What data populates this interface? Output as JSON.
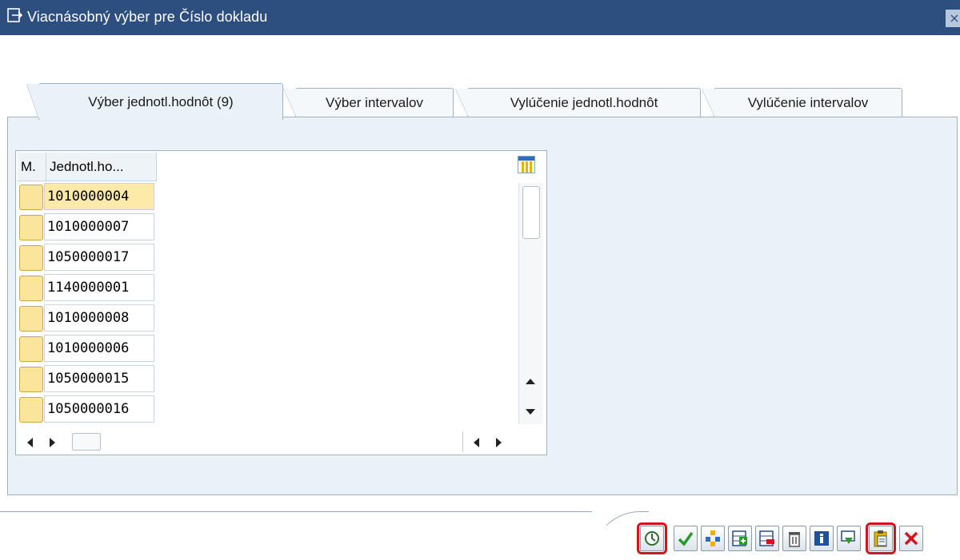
{
  "window": {
    "title": "Viacnásobný výber pre Číslo dokladu",
    "close_label": "×"
  },
  "tabs": [
    {
      "label": "Výber jednotl.hodnôt (9)",
      "active": true
    },
    {
      "label": "Výber intervalov",
      "active": false
    },
    {
      "label": "Vylúčenie jednotl.hodnôt",
      "active": false
    },
    {
      "label": "Vylúčenie intervalov",
      "active": false
    }
  ],
  "grid": {
    "col_m": "M.",
    "col_value": "Jednotl.ho...",
    "rows": [
      "1010000004",
      "1010000007",
      "1050000017",
      "1140000001",
      "1010000008",
      "1010000006",
      "1050000015",
      "1050000016"
    ],
    "focused_row": 0
  },
  "toolbar": {
    "buttons": [
      {
        "icon": "execute-clock-icon",
        "highlighted": true
      },
      {
        "icon": "checkmark-icon",
        "highlighted": false
      },
      {
        "icon": "multiple-selection-icon",
        "highlighted": false
      },
      {
        "icon": "insert-row-icon",
        "highlighted": false
      },
      {
        "icon": "delete-row-icon",
        "highlighted": false
      },
      {
        "icon": "trash-icon",
        "highlighted": false
      },
      {
        "icon": "info-icon",
        "highlighted": false
      },
      {
        "icon": "import-from-file-icon",
        "highlighted": false
      },
      {
        "icon": "paste-clipboard-icon",
        "highlighted": true
      },
      {
        "icon": "cancel-icon",
        "highlighted": false
      }
    ]
  },
  "colors": {
    "titlebar": "#2d4f80",
    "panel": "#eaf2f7",
    "highlight": "#d5121e"
  }
}
